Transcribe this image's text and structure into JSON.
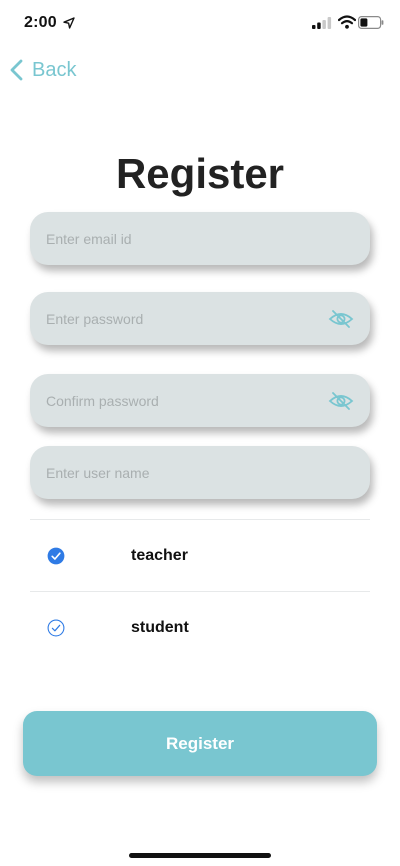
{
  "status_bar": {
    "time": "2:00",
    "icons": [
      "location-arrow-icon",
      "signal-icon",
      "wifi-icon",
      "battery-icon"
    ]
  },
  "nav": {
    "back_label": "Back",
    "back_icon": "chevron-left-icon"
  },
  "title": "Register",
  "fields": {
    "email": {
      "placeholder": "Enter email id",
      "value": ""
    },
    "password": {
      "placeholder": "Enter password",
      "value": "",
      "toggle_icon": "eye-off-icon"
    },
    "confirm_password": {
      "placeholder": "Confirm password",
      "value": "",
      "toggle_icon": "eye-off-icon"
    },
    "username": {
      "placeholder": "Enter user name",
      "value": ""
    }
  },
  "roles": [
    {
      "label": "teacher",
      "selected": true
    },
    {
      "label": "student",
      "selected": false
    }
  ],
  "register_button": {
    "label": "Register"
  },
  "colors": {
    "accent": "#79c6d0",
    "field_bg": "#dbe2e3",
    "check": "#2f7be5"
  }
}
